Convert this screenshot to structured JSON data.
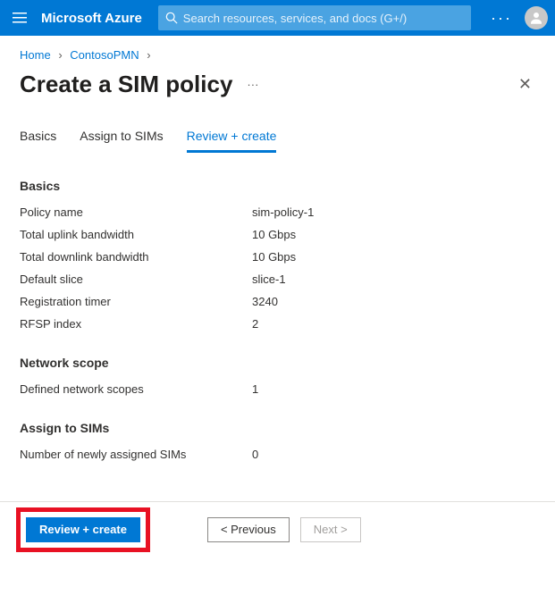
{
  "topbar": {
    "brand": "Microsoft Azure",
    "search_placeholder": "Search resources, services, and docs (G+/)",
    "more_label": "···"
  },
  "breadcrumb": {
    "items": [
      "Home",
      "ContosoPMN"
    ]
  },
  "page": {
    "title": "Create a SIM policy",
    "more": "···",
    "close": "✕"
  },
  "tabs": {
    "items": [
      {
        "label": "Basics",
        "active": false
      },
      {
        "label": "Assign to SIMs",
        "active": false
      },
      {
        "label": "Review + create",
        "active": true
      }
    ]
  },
  "review": {
    "sections": [
      {
        "title": "Basics",
        "rows": [
          {
            "k": "Policy name",
            "v": "sim-policy-1"
          },
          {
            "k": "Total uplink bandwidth",
            "v": "10 Gbps"
          },
          {
            "k": "Total downlink bandwidth",
            "v": "10 Gbps"
          },
          {
            "k": "Default slice",
            "v": "slice-1"
          },
          {
            "k": "Registration timer",
            "v": "3240"
          },
          {
            "k": "RFSP index",
            "v": "2"
          }
        ]
      },
      {
        "title": "Network scope",
        "rows": [
          {
            "k": "Defined network scopes",
            "v": "1"
          }
        ]
      },
      {
        "title": "Assign to SIMs",
        "rows": [
          {
            "k": "Number of newly assigned SIMs",
            "v": "0"
          }
        ]
      }
    ]
  },
  "footer": {
    "primary": "Review + create",
    "previous": "<  Previous",
    "next": "Next  >"
  }
}
